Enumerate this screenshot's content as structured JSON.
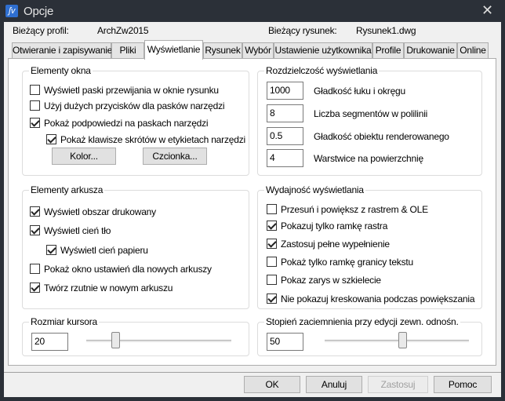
{
  "window": {
    "title": "Opcje",
    "close_icon": "close-icon"
  },
  "profile": {
    "label": "Bieżący profil:",
    "value": "ArchZw2015",
    "drawing_label": "Bieżący rysunek:",
    "drawing_value": "Rysunek1.dwg"
  },
  "tabs": [
    {
      "label": "Otwieranie i zapisywanie"
    },
    {
      "label": "Pliki"
    },
    {
      "label": "Wyświetlanie",
      "active": true
    },
    {
      "label": "Rysunek"
    },
    {
      "label": "Wybór"
    },
    {
      "label": "Ustawienie użytkownika"
    },
    {
      "label": "Profile"
    },
    {
      "label": "Drukowanie"
    },
    {
      "label": "Online"
    }
  ],
  "window_elements": {
    "title": "Elementy okna",
    "items": [
      {
        "label": "Wyświetl paski przewijania w oknie rysunku",
        "checked": false
      },
      {
        "label": "Użyj dużych przycisków dla pasków narzędzi",
        "checked": false
      },
      {
        "label": "Pokaż podpowiedzi na paskach narzędzi",
        "checked": true
      },
      {
        "label": "Pokaż klawisze skrótów w etykietach narzędzi",
        "checked": true
      }
    ],
    "color_button": "Kolor...",
    "font_button": "Czcionka..."
  },
  "resolution": {
    "title": "Rozdzielczość wyświetlania",
    "items": [
      {
        "value": "1000",
        "label": "Gładkość łuku i okręgu"
      },
      {
        "value": "8",
        "label": "Liczba segmentów w polilinii"
      },
      {
        "value": "0.5",
        "label": "Gładkość obiektu renderowanego"
      },
      {
        "value": "4",
        "label": "Warstwice na powierzchnię"
      }
    ]
  },
  "layout_elements": {
    "title": "Elementy arkusza",
    "items": [
      {
        "label": "Wyświetl obszar drukowany",
        "checked": true
      },
      {
        "label": "Wyświetl cień tło",
        "checked": true
      },
      {
        "label": "Wyświetl cień papieru",
        "checked": true
      },
      {
        "label": "Pokaż okno ustawień dla nowych arkuszy",
        "checked": false
      },
      {
        "label": "Twórz rzutnie w nowym arkuszu",
        "checked": true
      }
    ]
  },
  "performance": {
    "title": "Wydajność wyświetlania",
    "items": [
      {
        "label": "Przesuń i powiększ z rastrem & OLE",
        "checked": false
      },
      {
        "label": "Pokazuj tylko ramkę rastra",
        "checked": true
      },
      {
        "label": "Zastosuj pełne wypełnienie",
        "checked": true
      },
      {
        "label": "Pokaż tylko ramkę granicy tekstu",
        "checked": false
      },
      {
        "label": "Pokaz zarys w szkielecie",
        "checked": false
      },
      {
        "label": "Nie pokazuj kreskowania podczas powiększania",
        "checked": true
      }
    ]
  },
  "cursor_size": {
    "title": "Rozmiar kursora",
    "value": "20",
    "slider_fraction": 0.2
  },
  "xref_fade": {
    "title": "Stopień zaciemnienia przy edycji zewn. odnośn.",
    "value": "50",
    "slider_fraction": 0.54
  },
  "buttons": {
    "ok": "OK",
    "cancel": "Anuluj",
    "apply": "Zastosuj",
    "apply_disabled": true,
    "help": "Pomoc"
  }
}
